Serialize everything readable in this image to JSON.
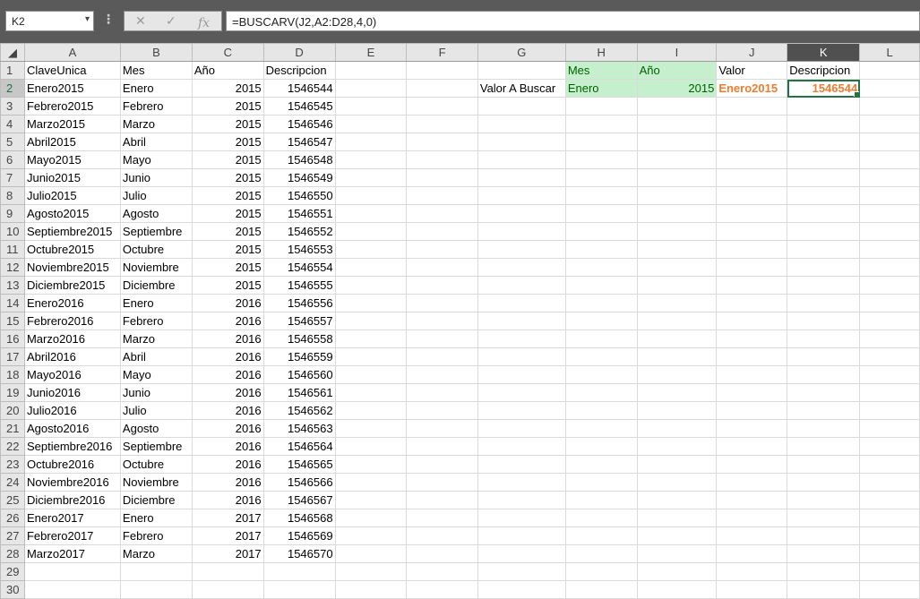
{
  "formula_bar": {
    "name_box": "K2",
    "formula": "=BUSCARV(J2,A2:D28,4,0)",
    "cancel_icon": "✕",
    "enter_icon": "✓",
    "fx_label": "fx"
  },
  "columns": [
    "A",
    "B",
    "C",
    "D",
    "E",
    "F",
    "G",
    "H",
    "I",
    "J",
    "K",
    "L"
  ],
  "rows": [
    [
      "ClaveUnica",
      "Mes",
      "Año",
      "Descripcion",
      "",
      "",
      "",
      "Mes",
      "Año",
      "Valor",
      "Descripcion",
      ""
    ],
    [
      "Enero2015",
      "Enero",
      "2015",
      "1546544",
      "",
      "",
      "Valor A  Buscar",
      "Enero",
      "2015",
      "Enero2015",
      "1546544",
      ""
    ],
    [
      "Febrero2015",
      "Febrero",
      "2015",
      "1546545",
      "",
      "",
      "",
      "",
      "",
      "",
      "",
      ""
    ],
    [
      "Marzo2015",
      "Marzo",
      "2015",
      "1546546",
      "",
      "",
      "",
      "",
      "",
      "",
      "",
      ""
    ],
    [
      "Abril2015",
      "Abril",
      "2015",
      "1546547",
      "",
      "",
      "",
      "",
      "",
      "",
      "",
      ""
    ],
    [
      "Mayo2015",
      "Mayo",
      "2015",
      "1546548",
      "",
      "",
      "",
      "",
      "",
      "",
      "",
      ""
    ],
    [
      "Junio2015",
      "Junio",
      "2015",
      "1546549",
      "",
      "",
      "",
      "",
      "",
      "",
      "",
      ""
    ],
    [
      "Julio2015",
      "Julio",
      "2015",
      "1546550",
      "",
      "",
      "",
      "",
      "",
      "",
      "",
      ""
    ],
    [
      "Agosto2015",
      "Agosto",
      "2015",
      "1546551",
      "",
      "",
      "",
      "",
      "",
      "",
      "",
      ""
    ],
    [
      "Septiembre2015",
      "Septiembre",
      "2015",
      "1546552",
      "",
      "",
      "",
      "",
      "",
      "",
      "",
      ""
    ],
    [
      "Octubre2015",
      "Octubre",
      "2015",
      "1546553",
      "",
      "",
      "",
      "",
      "",
      "",
      "",
      ""
    ],
    [
      "Noviembre2015",
      "Noviembre",
      "2015",
      "1546554",
      "",
      "",
      "",
      "",
      "",
      "",
      "",
      ""
    ],
    [
      "Diciembre2015",
      "Diciembre",
      "2015",
      "1546555",
      "",
      "",
      "",
      "",
      "",
      "",
      "",
      ""
    ],
    [
      "Enero2016",
      "Enero",
      "2016",
      "1546556",
      "",
      "",
      "",
      "",
      "",
      "",
      "",
      ""
    ],
    [
      "Febrero2016",
      "Febrero",
      "2016",
      "1546557",
      "",
      "",
      "",
      "",
      "",
      "",
      "",
      ""
    ],
    [
      "Marzo2016",
      "Marzo",
      "2016",
      "1546558",
      "",
      "",
      "",
      "",
      "",
      "",
      "",
      ""
    ],
    [
      "Abril2016",
      "Abril",
      "2016",
      "1546559",
      "",
      "",
      "",
      "",
      "",
      "",
      "",
      ""
    ],
    [
      "Mayo2016",
      "Mayo",
      "2016",
      "1546560",
      "",
      "",
      "",
      "",
      "",
      "",
      "",
      ""
    ],
    [
      "Junio2016",
      "Junio",
      "2016",
      "1546561",
      "",
      "",
      "",
      "",
      "",
      "",
      "",
      ""
    ],
    [
      "Julio2016",
      "Julio",
      "2016",
      "1546562",
      "",
      "",
      "",
      "",
      "",
      "",
      "",
      ""
    ],
    [
      "Agosto2016",
      "Agosto",
      "2016",
      "1546563",
      "",
      "",
      "",
      "",
      "",
      "",
      "",
      ""
    ],
    [
      "Septiembre2016",
      "Septiembre",
      "2016",
      "1546564",
      "",
      "",
      "",
      "",
      "",
      "",
      "",
      ""
    ],
    [
      "Octubre2016",
      "Octubre",
      "2016",
      "1546565",
      "",
      "",
      "",
      "",
      "",
      "",
      "",
      ""
    ],
    [
      "Noviembre2016",
      "Noviembre",
      "2016",
      "1546566",
      "",
      "",
      "",
      "",
      "",
      "",
      "",
      ""
    ],
    [
      "Diciembre2016",
      "Diciembre",
      "2016",
      "1546567",
      "",
      "",
      "",
      "",
      "",
      "",
      "",
      ""
    ],
    [
      "Enero2017",
      "Enero",
      "2017",
      "1546568",
      "",
      "",
      "",
      "",
      "",
      "",
      "",
      ""
    ],
    [
      "Febrero2017",
      "Febrero",
      "2017",
      "1546569",
      "",
      "",
      "",
      "",
      "",
      "",
      "",
      ""
    ],
    [
      "Marzo2017",
      "Marzo",
      "2017",
      "1546570",
      "",
      "",
      "",
      "",
      "",
      "",
      "",
      ""
    ],
    [
      "",
      "",
      "",
      "",
      "",
      "",
      "",
      "",
      "",
      "",
      "",
      ""
    ],
    [
      "",
      "",
      "",
      "",
      "",
      "",
      "",
      "",
      "",
      "",
      "",
      ""
    ]
  ],
  "row_numbers": [
    "1",
    "2",
    "3",
    "4",
    "5",
    "6",
    "7",
    "8",
    "9",
    "10",
    "11",
    "12",
    "13",
    "14",
    "15",
    "16",
    "17",
    "18",
    "19",
    "20",
    "21",
    "22",
    "23",
    "24",
    "25",
    "26",
    "27",
    "28",
    "29",
    "30"
  ],
  "selection": {
    "active_cell": "K2"
  },
  "colors": {
    "header_fill": "#c6efce",
    "header_text": "#006100",
    "result_text": "#ed7d31",
    "selection": "#217346"
  }
}
